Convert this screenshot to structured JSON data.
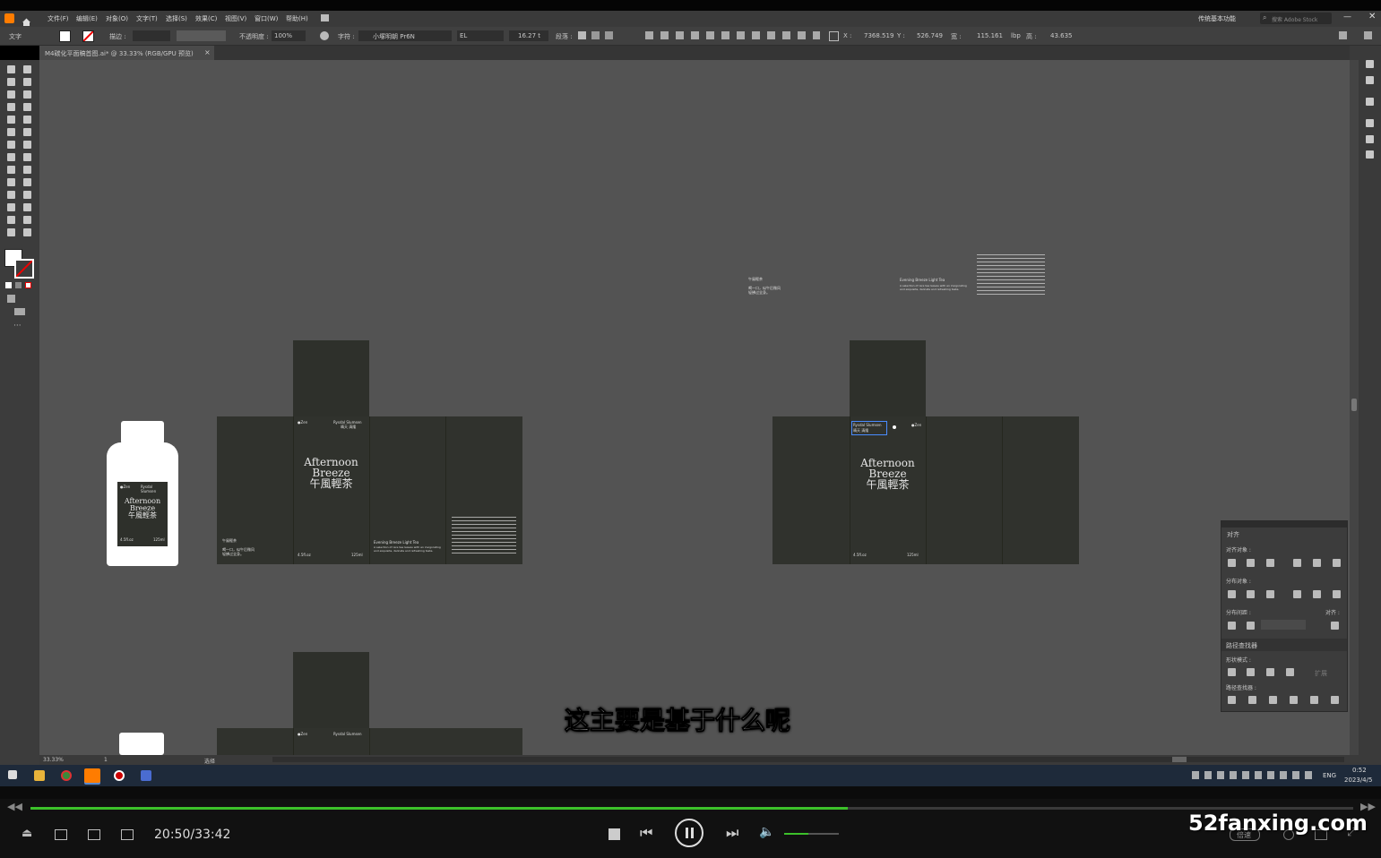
{
  "menu": {
    "items": [
      "文件(F)",
      "编辑(E)",
      "对象(O)",
      "文字(T)",
      "选择(S)",
      "效果(C)",
      "视图(V)",
      "窗口(W)",
      "帮助(H)"
    ],
    "workspace": "传统基本功能",
    "search_placeholder": "搜索 Adobe Stock"
  },
  "control": {
    "mode_label": "文字",
    "stroke_label": "描边 :",
    "opacity_label": "不透明度 :",
    "opacity_value": "100%",
    "char_label": "字符 :",
    "font_name": "小塚明朝 Pr6N",
    "font_style": "EL",
    "font_size": "16.27 t",
    "para_label": "段落 :",
    "x_label": "X :",
    "x_value": "7368.519",
    "y_label": "Y :",
    "y_value": "526.749",
    "w_label": "宽 :",
    "w_value": "115.161",
    "unit": "lbp",
    "h_label": "高 :",
    "h_value": "43.635"
  },
  "document": {
    "tab_title": "M4碳化平面稿首图.ai* @ 33.33% (RGB/GPU 预览)",
    "tab_close": "×"
  },
  "artwork": {
    "brand_small": "Rysdal Slumsen",
    "brand_cn": "晴天 清隆",
    "tag_left": "●Zen",
    "title_line1": "Afternoon",
    "title_line2": "Breeze",
    "title_cn": "午風輕茶",
    "volume_oz": "4.5fl.oz",
    "volume_ml": "125ml",
    "side_title": "午風輕茶",
    "side_sub": "喝一口，似午后微风",
    "side_sub2": "轻拂过全身。",
    "desc_title": "Evening Breeze Light Tea",
    "desc_text": "A selection of rare tea leaves with an invigorating and exquisite, delicate and refreshing taste.",
    "bottle_brand": "Rysdal Slumsen"
  },
  "align_panel": {
    "tab_label": "对齐",
    "align_objects": "对齐对象 :",
    "distribute_objects": "分布对象 :",
    "distribute_spacing": "分布间距 :",
    "align_to": "对齐 :",
    "pathfinder_tab": "路径查找器",
    "shape_modes": "形状模式 :",
    "pathfinders": "路径查找器 :",
    "expand": "扩展"
  },
  "status": {
    "zoom": "33.33%",
    "artboard": "1",
    "tool": "选择"
  },
  "subtitle": "这主要是基于什么呢",
  "taskbar": {
    "lang": "ENG",
    "time": "0:52",
    "date": "2023/4/5"
  },
  "player": {
    "time": "20:50/33:42",
    "progress": 0.618,
    "volume": 0.45,
    "speed_label": "倍速",
    "watermark": "52fanxing.com"
  },
  "colors": {
    "canvas": "#535353",
    "box": "#30322d",
    "progress": "#3cc12a",
    "accent": "#4a8cff"
  }
}
